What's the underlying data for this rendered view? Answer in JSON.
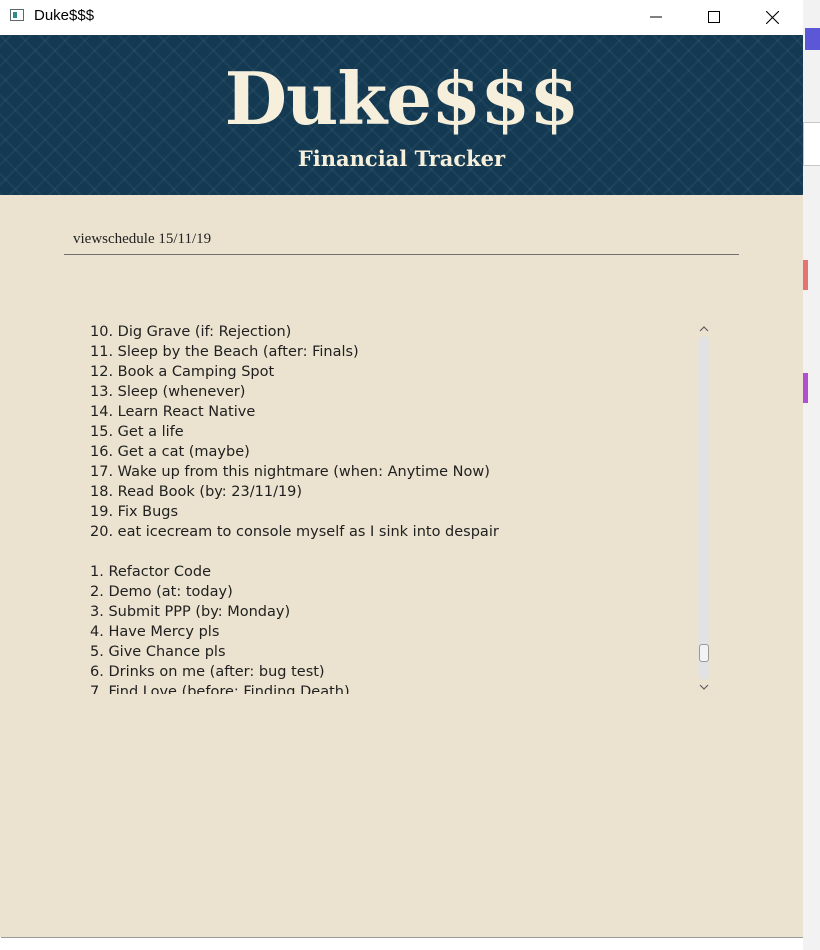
{
  "window": {
    "title": "Duke$$$",
    "controls": [
      "minimize-icon",
      "maximize-icon",
      "close-icon"
    ]
  },
  "banner": {
    "title": "Duke$$$",
    "subtitle": "Financial Tracker",
    "background_color": "#133a52",
    "text_color": "#f6efdb"
  },
  "command": {
    "value": "viewschedule 15/11/19"
  },
  "output": {
    "lines": [
      "10. Dig Grave (if: Rejection)",
      "11. Sleep by the Beach (after: Finals)",
      "12. Book a Camping Spot",
      "13. Sleep (whenever)",
      "14. Learn React Native",
      "15. Get a life",
      "16. Get a cat (maybe)",
      "17. Wake up from this nightmare (when: Anytime Now)",
      "18. Read Book (by: 23/11/19)",
      "19. Fix Bugs",
      "20. eat icecream to console myself as I sink into despair",
      "",
      "1. Refactor Code",
      "2. Demo (at: today)",
      "3. Submit PPP (by: Monday)",
      "4. Have Mercy pls",
      "5. Give Chance pls",
      "6. Drinks on me (after: bug test)",
      "7. Find Love (before: Finding Death)"
    ],
    "scroll_position": 0.95
  },
  "colors": {
    "content_background": "#ebe3d0"
  }
}
